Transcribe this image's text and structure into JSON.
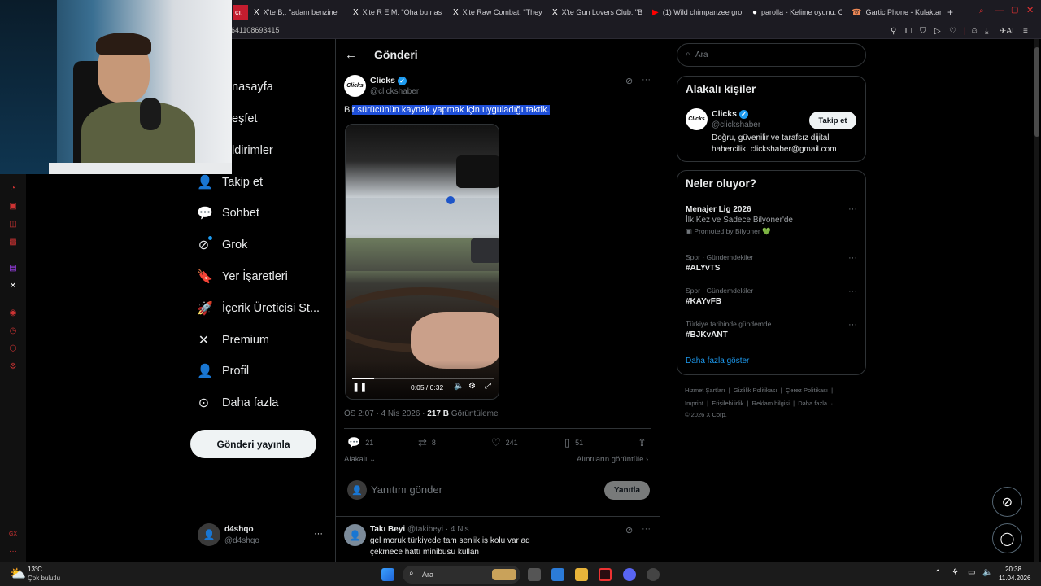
{
  "browser": {
    "tabs": [
      {
        "label": "cı:",
        "icon": ""
      },
      {
        "label": "X'te B,: \"adam benzine",
        "icon": "X"
      },
      {
        "label": "X'te R E M: \"Oha bu nası",
        "icon": "X"
      },
      {
        "label": "X'te Raw Combat: \"They",
        "icon": "X"
      },
      {
        "label": "X'te Gun Lovers Club: \"B",
        "icon": "X"
      },
      {
        "label": "(1) Wild chimpanzee gro",
        "icon": "▶"
      },
      {
        "label": "parolla - Kelime oyunu. C",
        "icon": "●"
      },
      {
        "label": "Gartic Phone - Kulaktan k",
        "icon": "☎"
      }
    ],
    "new_tab": "+",
    "url": "641108693415"
  },
  "nav": {
    "items": [
      {
        "label": "nasayfa",
        "icon": "home-icon"
      },
      {
        "label": "eşfet",
        "icon": "search-icon"
      },
      {
        "label": "ldirimler",
        "icon": "bell-icon"
      },
      {
        "label": "Takip et",
        "icon": "follow-icon",
        "glyph": "⁺👤"
      },
      {
        "label": "Sohbet",
        "icon": "chat-icon",
        "glyph": "◯"
      },
      {
        "label": "Grok",
        "icon": "grok-icon",
        "glyph": "⊘"
      },
      {
        "label": "Yer İşaretleri",
        "icon": "bookmark-icon",
        "glyph": "▯"
      },
      {
        "label": "İçerik Üreticisi St...",
        "icon": "rocket-icon",
        "glyph": "🚀"
      },
      {
        "label": "Premium",
        "icon": "x-logo-icon",
        "glyph": "𝕏"
      },
      {
        "label": "Profil",
        "icon": "profile-icon",
        "glyph": "👤"
      },
      {
        "label": "Daha fazla",
        "icon": "more-circle-icon",
        "glyph": "⊙"
      }
    ],
    "post_button": "Gönderi yayınla",
    "account": {
      "name": "d4shqo",
      "handle": "@d4shqo",
      "more": "···"
    }
  },
  "main": {
    "header_title": "Gönderi",
    "back": "←",
    "tweet": {
      "author": "Clicks",
      "handle": "@clickshaber",
      "avatar_text": "Clicks",
      "text_prefix": "Bi",
      "text_selected": "r sürücünün kaynak yapmak için uyguladığı taktik.",
      "more": "···",
      "video": {
        "time": "0:05 / 0:32",
        "progress": 0.156
      },
      "meta_time": "ÖS 2:07 · 4 Nis 2026 · ",
      "views_value": "217 B",
      "views_label": " Görüntüleme",
      "replies": "21",
      "retweets": "8",
      "likes": "241",
      "bookmarks": "51",
      "relevant": "Alakalı",
      "quotes": "Alıntıların görüntüle"
    },
    "reply_box": {
      "placeholder": "Yanıtını gönder",
      "button": "Yanıtla"
    },
    "reply": {
      "author": "Takı Beyi",
      "handle": "@takibeyi · 4 Nis",
      "text_line1": "gel moruk türkiyede tam senlik iş kolu var aq",
      "text_line2": "çekmece hattı minibüsü kullan",
      "more": "···"
    }
  },
  "right": {
    "search_placeholder": "Ara",
    "relevant_title": "Alakalı kişiler",
    "relevant_user": {
      "name": "Clicks",
      "handle": "@clickshaber",
      "bio_line1": "Doğru, güvenilir ve tarafsız dijital",
      "bio_line2": "habercilik. clickshaber@gmail.com",
      "follow": "Takip et"
    },
    "trends_title": "Neler oluyor?",
    "promo": {
      "title": "Menajer Lig 2026",
      "subtitle": "İlk Kez ve Sadece Bilyoner'de",
      "promoted": "Promoted by Bilyoner 💚"
    },
    "trends": [
      {
        "meta": "Spor · Gündemdekiler",
        "tag": "#ALYvTS"
      },
      {
        "meta": "Spor · Gündemdekiler",
        "tag": "#KAYvFB"
      },
      {
        "meta": "Türkiye tarihinde gündemde",
        "tag": "#BJKvANT"
      }
    ],
    "show_more": "Daha fazla göster",
    "footer_line1": "Hizmet Şartları  |  Gizlilik Politikası  |  Çerez Politikası  |",
    "footer_line2": "Imprint  |  Erişilebilirlik  |  Reklam bilgisi  |  Daha fazla ···",
    "footer_line3": "© 2026 X Corp."
  },
  "taskbar": {
    "weather_temp": "13°C",
    "weather_desc": "Çok bulutlu",
    "search": "Ara",
    "time": "20:38",
    "date": "11.04.2026"
  },
  "colors": {
    "accent": "#1d9bf0",
    "selection": "#1d4ed8",
    "background": "#000000",
    "border": "#2f3336"
  }
}
